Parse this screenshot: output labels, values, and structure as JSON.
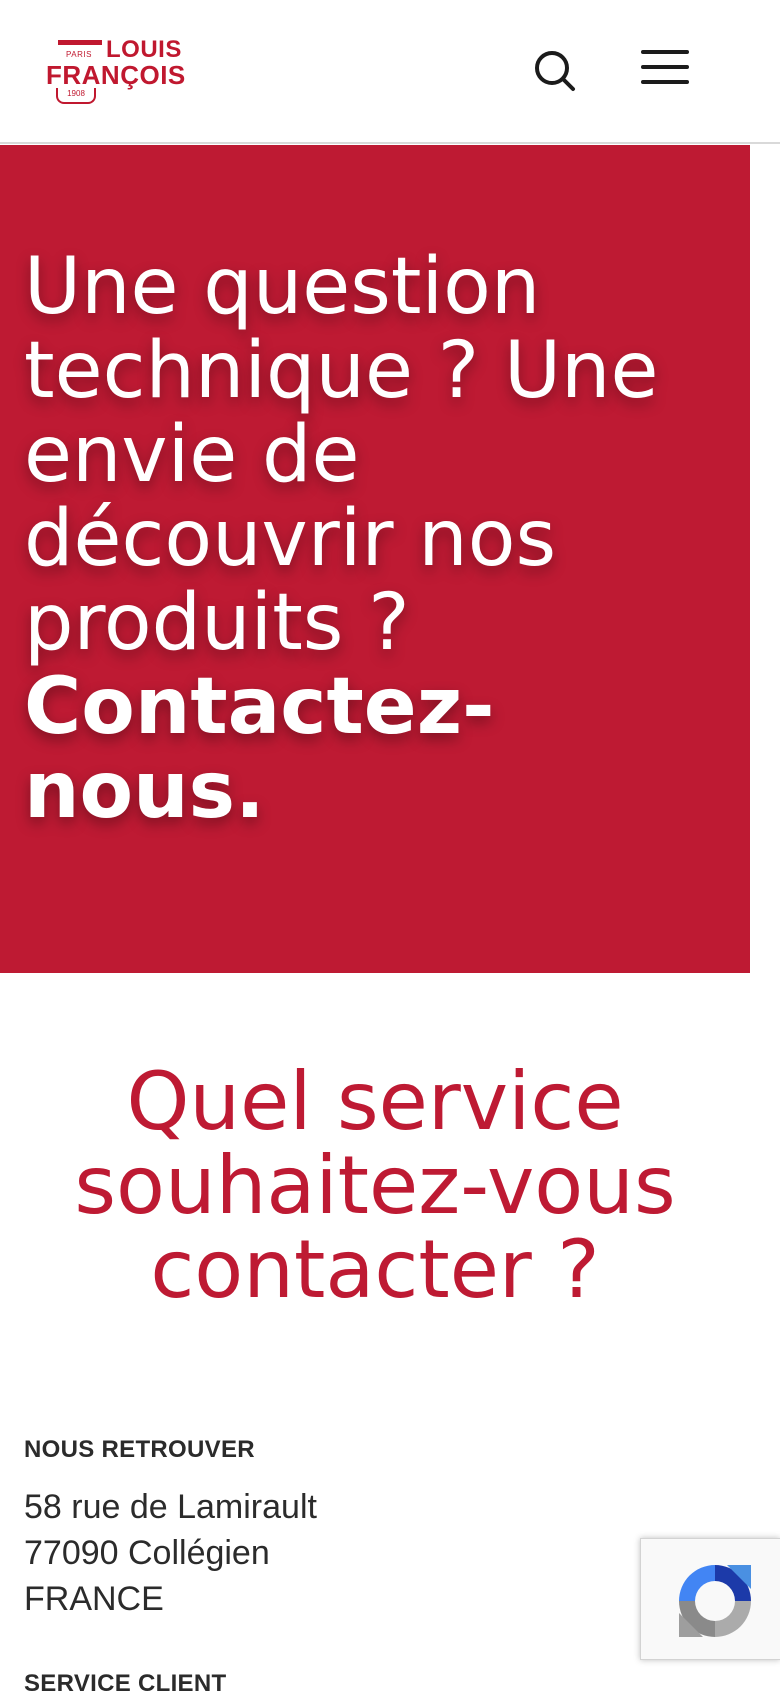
{
  "header": {
    "logo": {
      "paris": "PARIS",
      "louis": "LOUIS",
      "francois": "FRANÇOIS",
      "year": "1908"
    },
    "icons": [
      "search-icon",
      "menu-icon"
    ]
  },
  "hero": {
    "line1": "Une question technique ?",
    "line2": "Une envie de découvrir nos produits ?",
    "cta": "Contactez-nous.",
    "background": "#be1a33"
  },
  "service": {
    "title": "Quel service souhaitez-vous contacter ?"
  },
  "contact": {
    "find_us_label": "NOUS RETROUVER",
    "address": [
      "58 rue de Lamirault",
      "77090 Collégien",
      "FRANCE"
    ],
    "service_client_label": "SERVICE CLIENT"
  },
  "recaptcha": {
    "icon": "recaptcha-icon"
  },
  "colors": {
    "brand": "#be1a33",
    "text": "#2b2b2b"
  }
}
